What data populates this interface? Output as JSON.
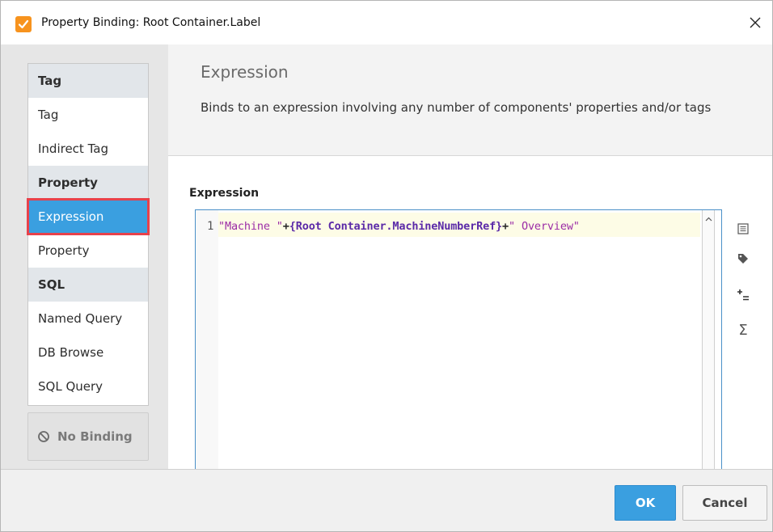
{
  "window": {
    "title": "Property Binding: Root Container.Label",
    "icon": "binding-check-icon",
    "accent_color": "#f7931e"
  },
  "sidebar": {
    "groups": [
      {
        "header": "Tag",
        "items": [
          {
            "label": "Tag"
          },
          {
            "label": "Indirect Tag"
          }
        ]
      },
      {
        "header": "Property",
        "items": [
          {
            "label": "Expression",
            "selected": true
          },
          {
            "label": "Property"
          }
        ]
      },
      {
        "header": "SQL",
        "items": [
          {
            "label": "Named Query"
          },
          {
            "label": "DB Browse"
          },
          {
            "label": "SQL Query"
          }
        ]
      }
    ],
    "no_binding_label": "No Binding",
    "no_binding_icon": "prohibited-icon",
    "selected_color": "#3a9fe0",
    "highlight_outline_color": "#e8414b"
  },
  "header": {
    "title": "Expression",
    "description": "Binds to an expression involving any number of components' properties and/or tags"
  },
  "editor": {
    "label": "Expression",
    "line_number": "1",
    "tokens": {
      "str1": "\"Machine \"",
      "op1": "+",
      "prop": "{Root Container.MachineNumberRef}",
      "op2": "+",
      "str2": "\" Overview\""
    }
  },
  "tools": [
    {
      "icon": "list-icon"
    },
    {
      "icon": "tag-icon"
    },
    {
      "icon": "insert-operator-icon"
    },
    {
      "icon": "sigma-function-icon",
      "glyph": "Σ"
    }
  ],
  "footer": {
    "ok_label": "OK",
    "cancel_label": "Cancel"
  }
}
